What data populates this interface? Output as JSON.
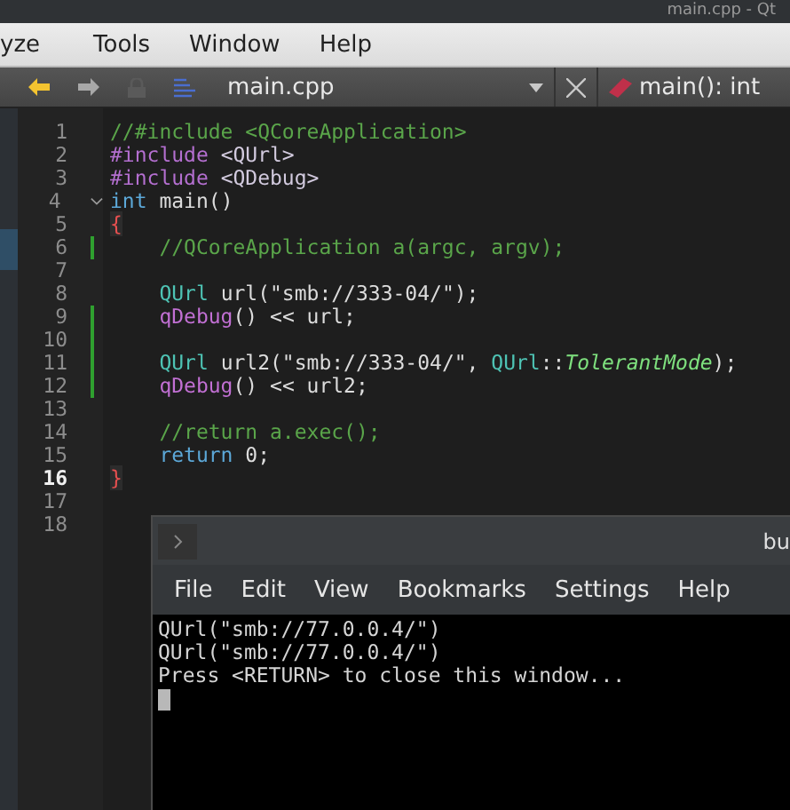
{
  "window": {
    "title": "main.cpp - Qt"
  },
  "menu": [
    "yze",
    "Tools",
    "Window",
    "Help"
  ],
  "toolbar": {
    "file": "main.cpp",
    "symbol": "main(): int"
  },
  "editor": {
    "lines": [
      {
        "number": "1",
        "changed": false,
        "current": false,
        "foldable": false,
        "tokens": [
          {
            "kind": "comment",
            "text": "//#include <QCoreApplication>"
          }
        ]
      },
      {
        "number": "2",
        "changed": false,
        "current": false,
        "foldable": false,
        "tokens": [
          {
            "kind": "preproc",
            "text": "#include"
          },
          {
            "kind": "path",
            "text": " <QUrl>"
          }
        ]
      },
      {
        "number": "3",
        "changed": false,
        "current": false,
        "foldable": false,
        "tokens": [
          {
            "kind": "preproc",
            "text": "#include"
          },
          {
            "kind": "path",
            "text": " <QDebug>"
          }
        ]
      },
      {
        "number": "4",
        "changed": false,
        "current": false,
        "foldable": true,
        "tokens": [
          {
            "kind": "keyword",
            "text": "int"
          },
          {
            "kind": "plain",
            "text": " main()"
          }
        ]
      },
      {
        "number": "5",
        "changed": false,
        "current": false,
        "foldable": false,
        "tokens": [
          {
            "kind": "brace",
            "text": "{"
          }
        ]
      },
      {
        "number": "6",
        "changed": true,
        "current": false,
        "foldable": false,
        "tokens": [
          {
            "kind": "comment",
            "text": "    //QCoreApplication a(argc, argv);"
          }
        ]
      },
      {
        "number": "7",
        "changed": false,
        "current": false,
        "foldable": false
      },
      {
        "number": "8",
        "changed": false,
        "current": false,
        "foldable": false,
        "tokens": [
          {
            "kind": "type",
            "text": "    QUrl"
          },
          {
            "kind": "plain",
            "text": " url(\"smb://333-04/\");"
          }
        ]
      },
      {
        "number": "9",
        "changed": true,
        "current": false,
        "foldable": false,
        "tokens": [
          {
            "kind": "func",
            "text": "    qDebug"
          },
          {
            "kind": "plain",
            "text": "() << url;"
          }
        ]
      },
      {
        "number": "10",
        "changed": true,
        "current": false,
        "foldable": false
      },
      {
        "number": "11",
        "changed": true,
        "current": false,
        "foldable": false,
        "tokens": [
          {
            "kind": "type",
            "text": "    QUrl"
          },
          {
            "kind": "plain",
            "text": " url2(\"smb://333-04/\", "
          },
          {
            "kind": "type",
            "text": "QUrl"
          },
          {
            "kind": "plain",
            "text": "::"
          },
          {
            "kind": "enum",
            "text": "TolerantMode"
          },
          {
            "kind": "plain",
            "text": ");"
          }
        ]
      },
      {
        "number": "12",
        "changed": true,
        "current": false,
        "foldable": false,
        "tokens": [
          {
            "kind": "func",
            "text": "    qDebug"
          },
          {
            "kind": "plain",
            "text": "() << url2;"
          }
        ]
      },
      {
        "number": "13",
        "changed": false,
        "current": false,
        "foldable": false
      },
      {
        "number": "14",
        "changed": false,
        "current": false,
        "foldable": false,
        "tokens": [
          {
            "kind": "comment",
            "text": "    //return a.exec();"
          }
        ]
      },
      {
        "number": "15",
        "changed": false,
        "current": false,
        "foldable": false,
        "tokens": [
          {
            "kind": "keyword",
            "text": "    return"
          },
          {
            "kind": "plain",
            "text": " 0;"
          }
        ]
      },
      {
        "number": "16",
        "changed": false,
        "current": true,
        "foldable": false,
        "tokens": [
          {
            "kind": "brace",
            "text": "}"
          }
        ]
      },
      {
        "number": "17",
        "changed": false,
        "current": false,
        "foldable": false
      },
      {
        "number": "18",
        "changed": false,
        "current": false,
        "foldable": false
      }
    ]
  },
  "terminal": {
    "title": "bu",
    "menu": [
      "File",
      "Edit",
      "View",
      "Bookmarks",
      "Settings",
      "Help"
    ],
    "output": [
      "QUrl(\"smb://77.0.0.4/\")",
      "QUrl(\"smb://77.0.0.4/\")",
      "Press <RETURN> to close this window..."
    ]
  }
}
